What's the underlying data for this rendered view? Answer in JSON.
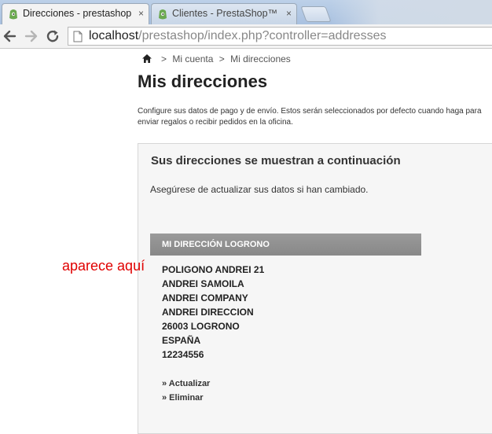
{
  "browser": {
    "tabs": [
      {
        "title": "Direcciones - prestashop",
        "active": true
      },
      {
        "title": "Clientes - PrestaShop™",
        "active": false
      }
    ],
    "tab_close_glyph": "×",
    "address_bar": {
      "host": "localhost",
      "path": "/prestashop/index.php?controller=addresses"
    },
    "nav_icons": [
      "back-arrow-icon",
      "forward-arrow-icon",
      "reload-icon"
    ]
  },
  "breadcrumb": {
    "home_icon": "home-icon",
    "sep1": ">",
    "account": "Mi cuenta",
    "sep2": ">",
    "current": "Mi direcciones"
  },
  "page": {
    "title": "Mis direcciones",
    "intro": "Configure sus datos de pago y de envío. Estos serán seleccionados por defecto cuando haga para enviar regalos o recibir pedidos en la oficina."
  },
  "addresses_panel": {
    "heading": "Sus direcciones se muestran a continuación",
    "note": "Asegúrese de actualizar sus datos si han cambiado.",
    "address": {
      "title": "MI DIRECCIÓN LOGRONO",
      "lines": [
        "POLIGONO ANDREI 21",
        "ANDREI SAMOILA",
        "ANDREI COMPANY",
        "ANDREI DIRECCION",
        "26003 LOGRONO",
        "ESPAÑA",
        "12234556"
      ],
      "update_label": "» Actualizar",
      "delete_label": "» Eliminar"
    }
  },
  "annotation": {
    "text": "aparece aquí",
    "color": "#e00000"
  },
  "colors": {
    "tabstrip": "#bcd0e8",
    "address_header": "#909090",
    "favicon_green": "#6aa84f"
  }
}
